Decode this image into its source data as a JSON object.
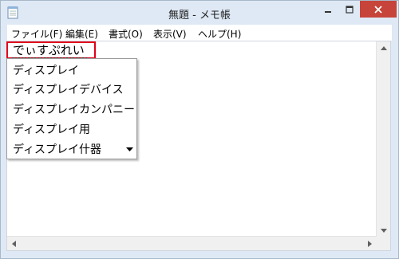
{
  "window": {
    "title": "無題 - メモ帳",
    "controls": {
      "minimize_icon": "minimize-icon",
      "maximize_icon": "maximize-icon",
      "close_icon": "close-icon"
    }
  },
  "menu": {
    "items": [
      {
        "label": "ファイル(F)"
      },
      {
        "label": "編集(E)"
      },
      {
        "label": "書式(O)"
      },
      {
        "label": "表示(V)"
      },
      {
        "label": "ヘルプ(H)"
      }
    ]
  },
  "editor": {
    "composing_text": "でぃすぷれい",
    "highlight_color": "#e0001a"
  },
  "candidates": {
    "items": [
      "ディスプレイ",
      "ディスプレイデバイス",
      "ディスプレイカンパニー",
      "ディスプレイ用",
      "ディスプレイ什器"
    ],
    "more_icon": "dropdown-arrow-icon"
  }
}
